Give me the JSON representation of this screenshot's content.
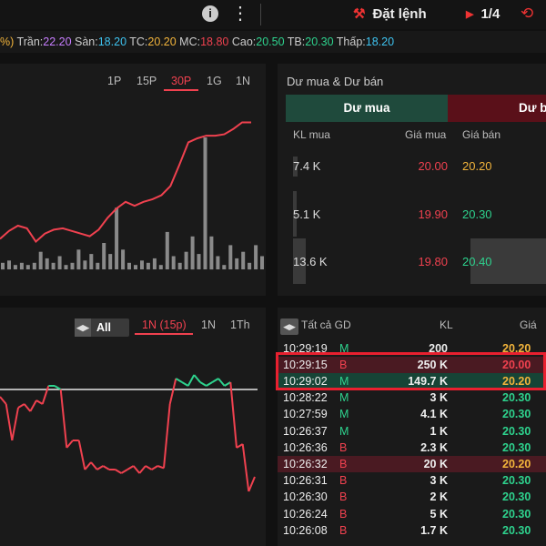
{
  "topbar": {
    "info_icon": "info-icon",
    "more_icon": "more-vertical-icon",
    "order_label": "Đặt lệnh",
    "order_icon": "gavel-icon",
    "pager_label": "1/4",
    "share_icon": "share-icon"
  },
  "pricebar": {
    "lead": "%)",
    "ceiling_label": "Trần:",
    "ceiling": "22.20",
    "floor_label": "Sàn:",
    "floor": "18.20",
    "ref_label": "TC:",
    "ref": "20.20",
    "match_label": "MC:",
    "match": "18.80",
    "high_label": "Cao:",
    "high": "20.50",
    "avg_label": "TB:",
    "avg": "20.30",
    "low_label": "Thấp:",
    "low": "18.20"
  },
  "chart1": {
    "timeframes": [
      "1P",
      "15P",
      "30P",
      "1G",
      "1N"
    ],
    "active_timeframe": "30P",
    "price_line": [
      14.2,
      14.8,
      15.2,
      15.0,
      14.0,
      14.6,
      14.9,
      15.0,
      14.8,
      14.6,
      14.4,
      14.9,
      15.8,
      16.5,
      17.0,
      16.7,
      17.0,
      17.2,
      17.5,
      18.2,
      19.8,
      21.5,
      21.8,
      22.0,
      22.0,
      22.1,
      22.5,
      23.0,
      23.0
    ],
    "volume": [
      3,
      4,
      2,
      3,
      2,
      3,
      8,
      5,
      3,
      6,
      2,
      3,
      9,
      4,
      7,
      3,
      12,
      7,
      28,
      9,
      3,
      2,
      4,
      3,
      5,
      2,
      17,
      6,
      3,
      8,
      15,
      7,
      60,
      15,
      6,
      2,
      11,
      5,
      8,
      3,
      11,
      6
    ]
  },
  "chart2": {
    "toggle_label": "All",
    "timeframes": [
      "1N (15p)",
      "1N",
      "1Th"
    ],
    "active_timeframe": "1N (15p)",
    "reference_level": 0.5,
    "flow_line": [
      0.4,
      0.3,
      -0.2,
      0.25,
      0.3,
      0.2,
      0.35,
      0.3,
      0.55,
      0.55,
      0.5,
      -0.3,
      -0.2,
      -0.2,
      -0.6,
      -0.5,
      -0.6,
      -0.55,
      -0.6,
      -0.6,
      -0.65,
      -0.6,
      -0.55,
      -0.65,
      -0.55,
      -0.6,
      -0.55,
      -0.58,
      0.3,
      0.65,
      0.6,
      0.55,
      0.7,
      0.6,
      0.55,
      0.6,
      0.65,
      0.55,
      0.6,
      -0.3,
      -0.25,
      -0.9,
      -0.7
    ]
  },
  "depth": {
    "title": "Dư mua & Dư bán",
    "tab_buy": "Dư mua",
    "tab_sell": "Dư bán",
    "headers": {
      "vol": "KL mua",
      "buy_price": "Giá mua",
      "sell_price": "Giá bán"
    },
    "rows": [
      {
        "vol": "7.4 K",
        "buy_price": "20.00",
        "sell_price": "20.20",
        "sell_color": "#f2b43b"
      },
      {
        "vol": "5.1 K",
        "buy_price": "19.90",
        "sell_price": "20.30",
        "sell_color": "#2ed38e"
      },
      {
        "vol": "13.6 K",
        "buy_price": "19.80",
        "sell_price": "20.40",
        "sell_color": "#2ed38e"
      }
    ]
  },
  "trades": {
    "toggle_label": "Tất cả GD",
    "headers": {
      "vol": "KL",
      "price": "Giá"
    },
    "rows": [
      {
        "time": "10:29:19",
        "side": "M",
        "vol": "200",
        "price": "20.20",
        "price_color": "#f2b43b",
        "hl": ""
      },
      {
        "time": "10:29:15",
        "side": "B",
        "vol": "250 K",
        "price": "20.00",
        "price_color": "#f0414f",
        "hl": "red"
      },
      {
        "time": "10:29:02",
        "side": "M",
        "vol": "149.7 K",
        "price": "20.20",
        "price_color": "#f2b43b",
        "hl": "green"
      },
      {
        "time": "10:28:22",
        "side": "M",
        "vol": "3 K",
        "price": "20.30",
        "price_color": "#2ed38e",
        "hl": ""
      },
      {
        "time": "10:27:59",
        "side": "M",
        "vol": "4.1 K",
        "price": "20.30",
        "price_color": "#2ed38e",
        "hl": ""
      },
      {
        "time": "10:26:37",
        "side": "M",
        "vol": "1 K",
        "price": "20.30",
        "price_color": "#2ed38e",
        "hl": ""
      },
      {
        "time": "10:26:36",
        "side": "B",
        "vol": "2.3 K",
        "price": "20.30",
        "price_color": "#2ed38e",
        "hl": ""
      },
      {
        "time": "10:26:32",
        "side": "B",
        "vol": "20 K",
        "price": "20.20",
        "price_color": "#f2b43b",
        "hl": "red"
      },
      {
        "time": "10:26:31",
        "side": "B",
        "vol": "3 K",
        "price": "20.30",
        "price_color": "#2ed38e",
        "hl": ""
      },
      {
        "time": "10:26:30",
        "side": "B",
        "vol": "2 K",
        "price": "20.30",
        "price_color": "#2ed38e",
        "hl": ""
      },
      {
        "time": "10:26:24",
        "side": "B",
        "vol": "5 K",
        "price": "20.30",
        "price_color": "#2ed38e",
        "hl": ""
      },
      {
        "time": "10:26:08",
        "side": "B",
        "vol": "1.7 K",
        "price": "20.30",
        "price_color": "#2ed38e",
        "hl": ""
      }
    ]
  },
  "colors": {
    "buy": "#2ed38e",
    "sell": "#f0414f",
    "ref": "#f2b43b",
    "accent_red": "#e8202f"
  }
}
